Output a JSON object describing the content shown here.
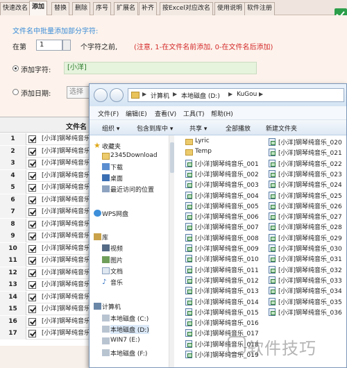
{
  "app": {
    "tabs": [
      "快速改名",
      "添加",
      "替换",
      "删除",
      "序号",
      "扩展名",
      "补齐",
      "按Excel对应改名",
      "使用说明",
      "软件注册"
    ],
    "active_tab": "添加",
    "description": "文件名中批量添加部分字符:",
    "position_prefix": "在第",
    "position_value": "1",
    "position_suffix": "个字符之前,",
    "position_note": "(注意, 1-在文件名前添加, 0-在文件名后添加)",
    "add_char_label": "添加字符:",
    "add_char_value": "[小洋]",
    "add_date_label": "添加日期:",
    "date_select": "选择"
  },
  "grid": {
    "header": "文件名",
    "rows": [
      {
        "num": "1",
        "name": "[小洋]钢琴纯音乐"
      },
      {
        "num": "2",
        "name": "[小洋]钢琴纯音乐"
      },
      {
        "num": "3",
        "name": "[小洋]钢琴纯音乐"
      },
      {
        "num": "4",
        "name": "[小洋]钢琴纯音乐"
      },
      {
        "num": "5",
        "name": "[小洋]钢琴纯音乐"
      },
      {
        "num": "6",
        "name": "[小洋]钢琴纯音乐"
      },
      {
        "num": "7",
        "name": "[小洋]钢琴纯音乐"
      },
      {
        "num": "8",
        "name": "[小洋]钢琴纯音乐"
      },
      {
        "num": "9",
        "name": "[小洋]钢琴纯音乐"
      },
      {
        "num": "10",
        "name": "[小洋]钢琴纯音乐"
      },
      {
        "num": "11",
        "name": "[小洋]钢琴纯音乐"
      },
      {
        "num": "12",
        "name": "[小洋]钢琴纯音乐"
      },
      {
        "num": "13",
        "name": "[小洋]钢琴纯音乐"
      },
      {
        "num": "14",
        "name": "[小洋]钢琴纯音乐"
      },
      {
        "num": "15",
        "name": "[小洋]钢琴纯音乐"
      },
      {
        "num": "16",
        "name": "[小洋]钢琴纯音乐"
      },
      {
        "num": "17",
        "name": "[小洋]钢琴纯音乐"
      }
    ]
  },
  "explorer": {
    "breadcrumb": [
      "计算机",
      "本地磁盘 (D:)",
      "KuGou"
    ],
    "menus": [
      "文件(F)",
      "编辑(E)",
      "查看(V)",
      "工具(T)",
      "帮助(H)"
    ],
    "toolbar": [
      "组织 ▾",
      "包含到库中 ▾",
      "共享 ▾",
      "全部播放",
      "新建文件夹"
    ],
    "nav": {
      "favorites": "收藏夹",
      "fav_items": [
        "2345Download",
        "下载",
        "桌面",
        "最近访问的位置"
      ],
      "wps": "WPS网盘",
      "libraries": "库",
      "lib_items": [
        "视频",
        "图片",
        "文档",
        "音乐"
      ],
      "computer": "计算机",
      "drives": [
        "本地磁盘 (C:)",
        "本地磁盘 (D:)",
        "WIN7 (E:)",
        "本地磁盘 (F:)"
      ]
    },
    "col1": [
      "Lyric",
      "Temp",
      "[小洋]钢琴纯音乐_001",
      "[小洋]钢琴纯音乐_002",
      "[小洋]钢琴纯音乐_003",
      "[小洋]钢琴纯音乐_004",
      "[小洋]钢琴纯音乐_005",
      "[小洋]钢琴纯音乐_006",
      "[小洋]钢琴纯音乐_007",
      "[小洋]钢琴纯音乐_008",
      "[小洋]钢琴纯音乐_009",
      "[小洋]钢琴纯音乐_010",
      "[小洋]钢琴纯音乐_011",
      "[小洋]钢琴纯音乐_012",
      "[小洋]钢琴纯音乐_013",
      "[小洋]钢琴纯音乐_014",
      "[小洋]钢琴纯音乐_015",
      "[小洋]钢琴纯音乐_016",
      "[小洋]钢琴纯音乐_017",
      "[小洋]钢琴纯音乐_018",
      "[小洋]钢琴纯音乐_019"
    ],
    "col2": [
      "[小洋]钢琴纯音乐_020",
      "[小洋]钢琴纯音乐_021",
      "[小洋]钢琴纯音乐_022",
      "[小洋]钢琴纯音乐_023",
      "[小洋]钢琴纯音乐_024",
      "[小洋]钢琴纯音乐_025",
      "[小洋]钢琴纯音乐_026",
      "[小洋]钢琴纯音乐_027",
      "[小洋]钢琴纯音乐_028",
      "[小洋]钢琴纯音乐_029",
      "[小洋]钢琴纯音乐_030",
      "[小洋]钢琴纯音乐_031",
      "[小洋]钢琴纯音乐_032",
      "[小洋]钢琴纯音乐_033",
      "[小洋]钢琴纯音乐_034",
      "[小洋]钢琴纯音乐_035",
      "[小洋]钢琴纯音乐_036"
    ]
  },
  "watermark": "软件技巧"
}
